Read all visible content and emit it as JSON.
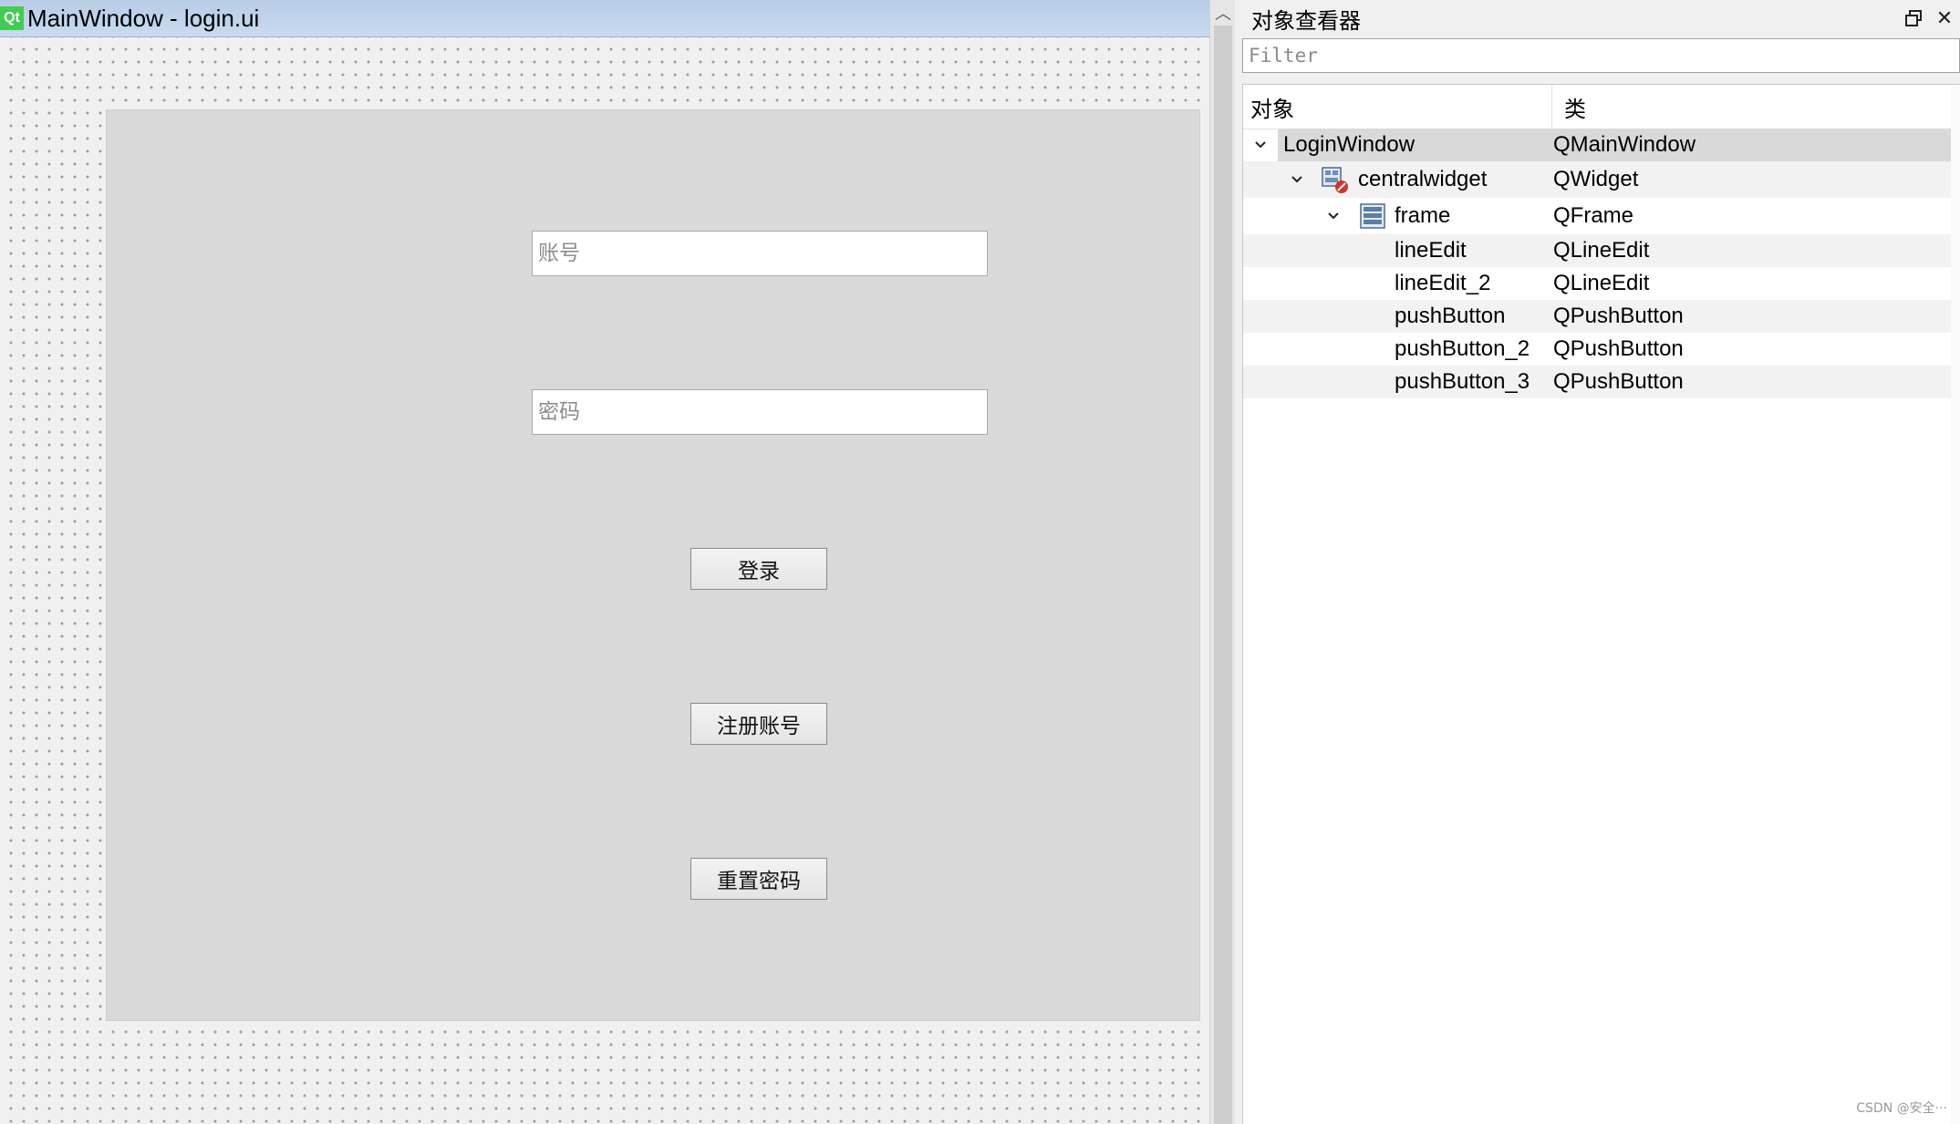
{
  "editor": {
    "window_title": "MainWindow - login.ui",
    "qt_logo": "Qt",
    "form": {
      "account_placeholder": "账号",
      "password_placeholder": "密码",
      "login_button": "登录",
      "register_button": "注册账号",
      "reset_button": "重置密码"
    }
  },
  "inspector": {
    "title": "对象查看器",
    "float_icon": "float-dock-icon",
    "close_icon": "close-icon",
    "filter_placeholder": "Filter",
    "columns": {
      "object": "对象",
      "class": "类"
    },
    "rows": [
      {
        "object": "LoginWindow",
        "class": "QMainWindow",
        "level": 0,
        "expanded": true,
        "icon": "",
        "selected": true
      },
      {
        "object": "centralwidget",
        "class": "QWidget",
        "level": 1,
        "expanded": true,
        "icon": "widget-layout-broken-icon"
      },
      {
        "object": "frame",
        "class": "QFrame",
        "level": 2,
        "expanded": true,
        "icon": "vertical-layout-icon"
      },
      {
        "object": "lineEdit",
        "class": "QLineEdit",
        "level": 3
      },
      {
        "object": "lineEdit_2",
        "class": "QLineEdit",
        "level": 3
      },
      {
        "object": "pushButton",
        "class": "QPushButton",
        "level": 3
      },
      {
        "object": "pushButton_2",
        "class": "QPushButton",
        "level": 3
      },
      {
        "object": "pushButton_3",
        "class": "QPushButton",
        "level": 3
      }
    ]
  },
  "watermark": "CSDN @安全···"
}
